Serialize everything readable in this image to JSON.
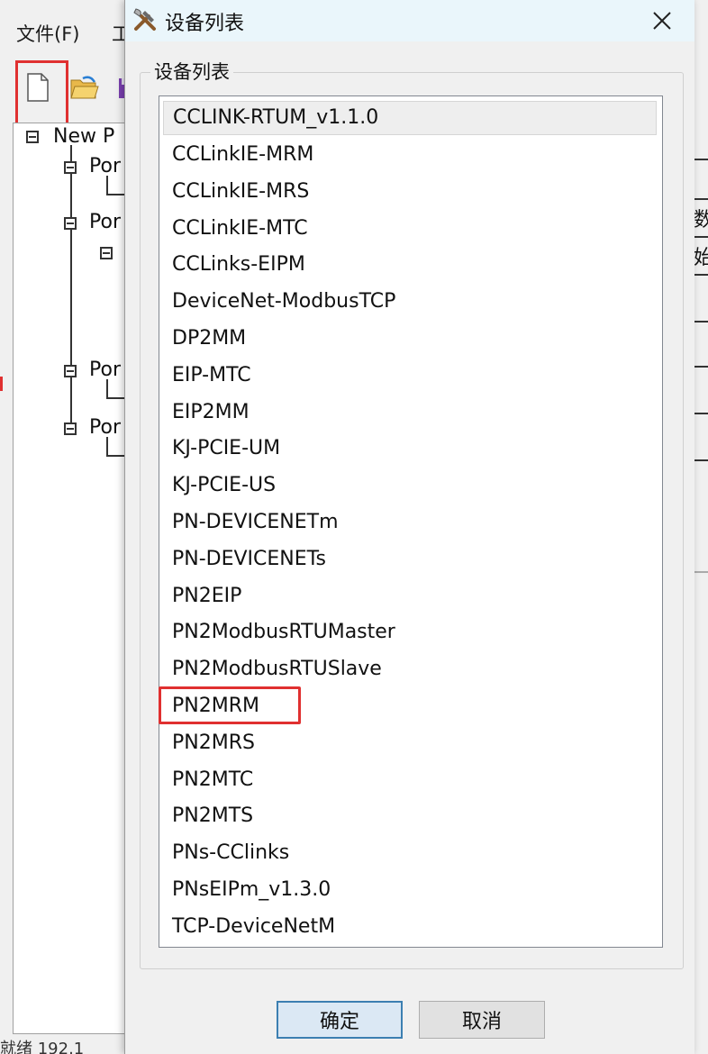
{
  "main_window": {
    "menu": {
      "file": "文件(F)",
      "next": "工"
    },
    "tree": {
      "root": "New P",
      "ports": [
        "Por",
        "Por",
        "Por",
        "Por"
      ]
    },
    "status_text": "就绪  192.1",
    "right_strip_chars": [
      "数",
      "始"
    ]
  },
  "dialog": {
    "title": "设备列表",
    "group_label": "设备列表",
    "selected_item": "CCLINK-RTUM_v1.1.0",
    "highlighted_item": "PN2MRM",
    "items": [
      "CCLINK-RTUM_v1.1.0",
      "CCLinkIE-MRM",
      "CCLinkIE-MRS",
      "CCLinkIE-MTC",
      "CCLinks-EIPM",
      "DeviceNet-ModbusTCP",
      "DP2MM",
      "EIP-MTC",
      "EIP2MM",
      "KJ-PCIE-UM",
      "KJ-PCIE-US",
      "PN-DEVICENETm",
      "PN-DEVICENETs",
      "PN2EIP",
      "PN2ModbusRTUMaster",
      "PN2ModbusRTUSlave",
      "PN2MRM",
      "PN2MRS",
      "PN2MTC",
      "PN2MTS",
      "PNs-CClinks",
      "PNsEIPm_v1.3.0",
      "TCP-DeviceNetM"
    ],
    "ok_label": "确定",
    "cancel_label": "取消"
  },
  "colors": {
    "highlight_red": "#e03030",
    "titlebar_bg": "#eaf6fb",
    "ok_button_border": "#3c7fb1"
  }
}
